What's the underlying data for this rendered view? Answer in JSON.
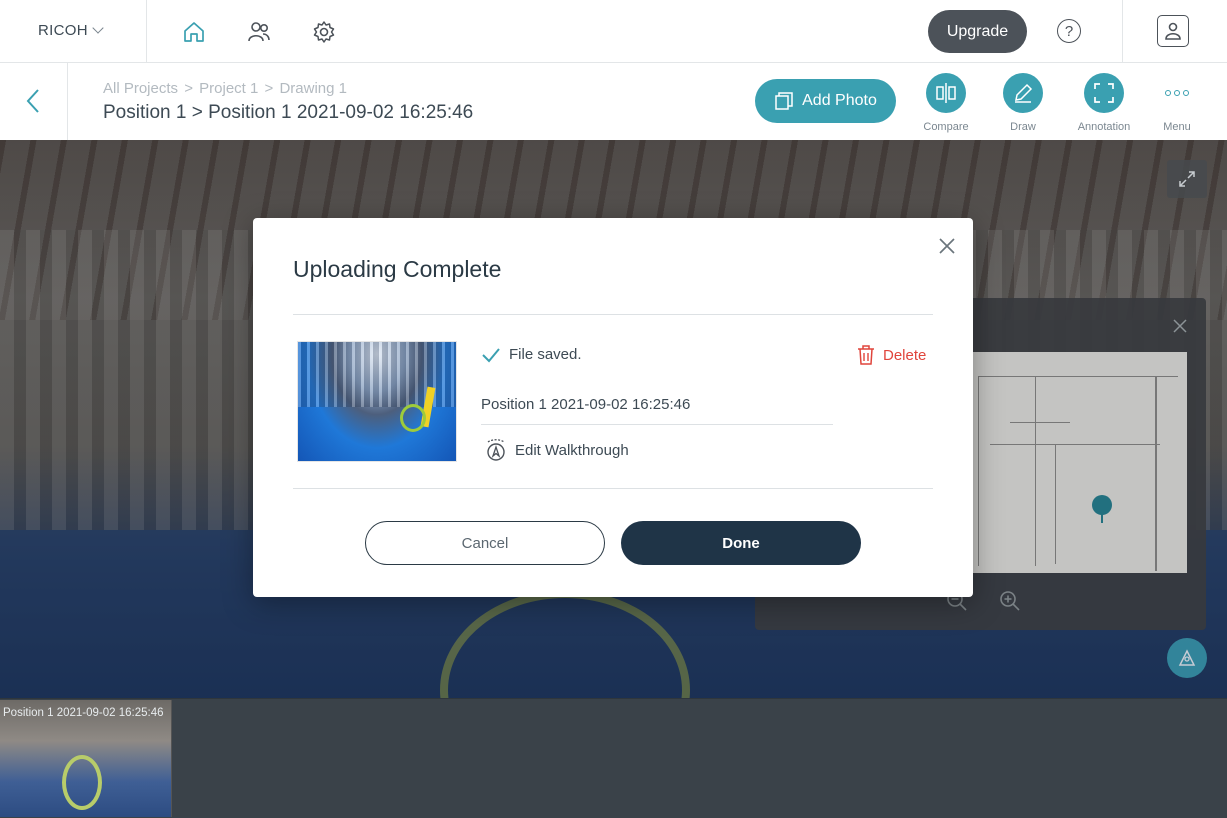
{
  "topbar": {
    "brand": "RICOH",
    "upgrade_label": "Upgrade",
    "help_label": "?",
    "icons": [
      "home-icon",
      "users-icon",
      "gear-icon",
      "help-icon",
      "profile-icon"
    ]
  },
  "subbar": {
    "breadcrumbs": [
      "All Projects",
      "Project 1",
      "Drawing 1"
    ],
    "crumb_sep": ">",
    "title": "Position 1 > Position 1 2021-09-02 16:25:46",
    "add_photo_label": "Add Photo",
    "tools": [
      {
        "label": "Compare",
        "icon": "compare-icon"
      },
      {
        "label": "Draw",
        "icon": "pencil-icon"
      },
      {
        "label": "Annotation",
        "icon": "annotation-icon"
      },
      {
        "label": "Menu",
        "icon": "more-icon"
      }
    ]
  },
  "filmstrip": {
    "items": [
      {
        "label": "Position 1 2021-09-02 16:25:46"
      }
    ]
  },
  "modal": {
    "title": "Uploading Complete",
    "status": "File saved.",
    "delete_label": "Delete",
    "position_name": "Position 1 2021-09-02 16:25:46",
    "edit_walkthrough_label": "Edit Walkthrough",
    "cancel_label": "Cancel",
    "done_label": "Done"
  },
  "colors": {
    "accent": "#3aa0b1",
    "primary_dark": "#1f3447",
    "danger": "#e0453c",
    "success": "#3aa0b1"
  }
}
